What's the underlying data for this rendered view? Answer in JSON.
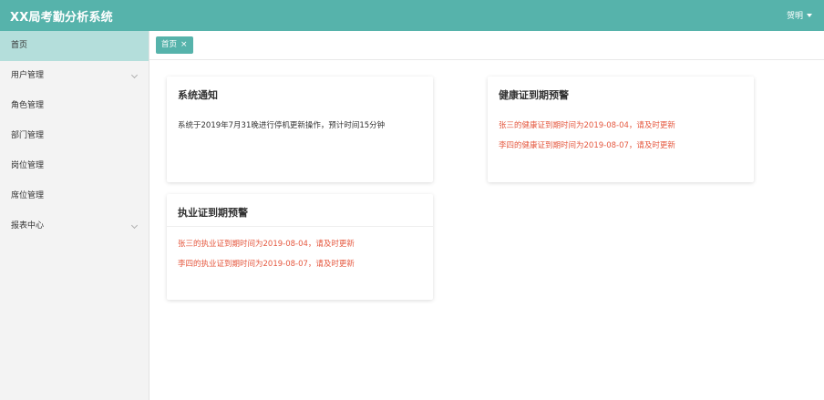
{
  "header": {
    "title": "XX局考勤分析系统",
    "user_name": "贺明"
  },
  "sidebar": {
    "items": [
      {
        "label": "首页",
        "has_children": false,
        "active": true
      },
      {
        "label": "用户管理",
        "has_children": true,
        "active": false
      },
      {
        "label": "角色管理",
        "has_children": false,
        "active": false
      },
      {
        "label": "部门管理",
        "has_children": false,
        "active": false
      },
      {
        "label": "岗位管理",
        "has_children": false,
        "active": false
      },
      {
        "label": "席位管理",
        "has_children": false,
        "active": false
      },
      {
        "label": "报表中心",
        "has_children": true,
        "active": false
      }
    ]
  },
  "tabs": [
    {
      "label": "首页",
      "close": "×"
    }
  ],
  "cards": {
    "notice": {
      "title": "系统通知",
      "lines": [
        "系统于2019年7月31晚进行停机更新操作，预计时间15分钟"
      ]
    },
    "health": {
      "title": "健康证到期预警",
      "lines": [
        "张三的健康证到期时间为2019-08-04，请及时更新",
        "李四的健康证到期时间为2019-08-07，请及时更新"
      ]
    },
    "license": {
      "title": "执业证到期预警",
      "lines": [
        "张三的执业证到期时间为2019-08-04，请及时更新",
        "李四的执业证到期时间为2019-08-07，请及时更新"
      ]
    }
  },
  "colors": {
    "brand": "#56b3ab",
    "sidebar_active": "#b4dedb",
    "warning_text": "#e5583f"
  }
}
